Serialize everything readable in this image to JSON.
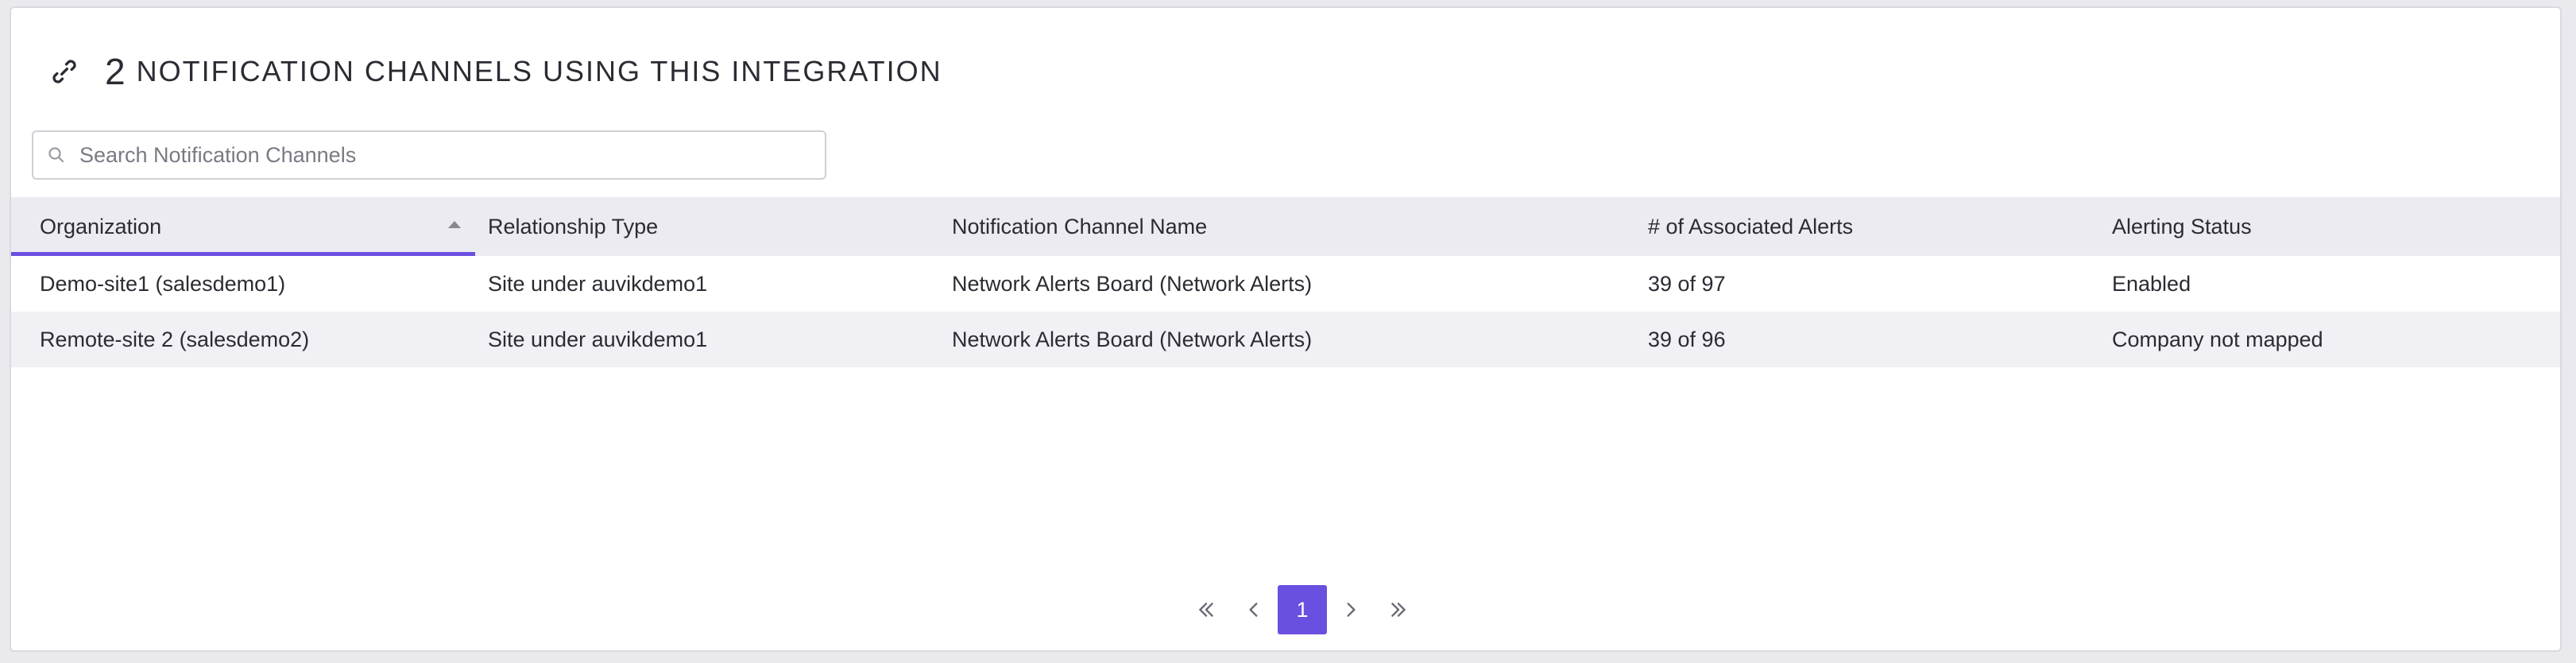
{
  "header": {
    "count": "2",
    "title": "NOTIFICATION CHANNELS USING THIS INTEGRATION",
    "icon": "link-icon"
  },
  "search": {
    "placeholder": "Search Notification Channels",
    "value": ""
  },
  "table": {
    "columns": [
      "Organization",
      "Relationship Type",
      "Notification Channel Name",
      "# of Associated Alerts",
      "Alerting Status"
    ],
    "sorted_column": "Organization",
    "rows": [
      [
        "Demo-site1 (salesdemo1)",
        "Site under auvikdemo1",
        "Network Alerts Board (Network Alerts)",
        "39 of 97",
        "Enabled"
      ],
      [
        "Remote-site 2 (salesdemo2)",
        "Site under auvikdemo1",
        "Network Alerts Board (Network Alerts)",
        "39 of 96",
        "Company not mapped"
      ]
    ]
  },
  "pagination": {
    "current_page": "1"
  },
  "colors": {
    "accent": "#6b4fe0",
    "header_bg": "#ebebf1",
    "row_alt_bg": "#f0f0f5"
  }
}
